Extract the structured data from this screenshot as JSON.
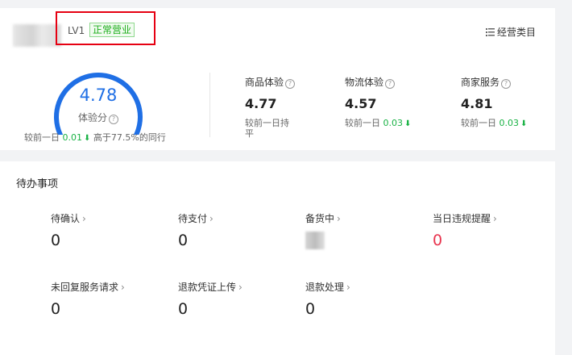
{
  "header": {
    "level": "LV1",
    "status": "正常营业",
    "category_link": "经营类目"
  },
  "score": {
    "value": "4.78",
    "fraction": 0.95,
    "label": "体验分",
    "compare_prefix": "较前一日",
    "compare_delta": "0.01",
    "compare_suffix": "高于77.5%的同行"
  },
  "metrics": [
    {
      "title": "商品体验",
      "value": "4.77",
      "sub": "较前一日持平",
      "delta": ""
    },
    {
      "title": "物流体验",
      "value": "4.57",
      "sub": "较前一日",
      "delta": "0.03"
    },
    {
      "title": "商家服务",
      "value": "4.81",
      "sub": "较前一日",
      "delta": "0.03"
    }
  ],
  "todo": {
    "title": "待办事项",
    "items": [
      {
        "label": "待确认",
        "value": "0"
      },
      {
        "label": "待支付",
        "value": "0"
      },
      {
        "label": "备货中",
        "value": ""
      },
      {
        "label": "当日违规提醒",
        "value": "0"
      },
      {
        "label": "未回复服务请求",
        "value": "0"
      },
      {
        "label": "退款凭证上传",
        "value": "0"
      },
      {
        "label": "退款处理",
        "value": "0"
      }
    ]
  },
  "colors": {
    "accent": "#1f6fe5",
    "positive": "#19b244",
    "alert": "#e8344e",
    "highlight_box": "#e60012"
  },
  "icons": {
    "category": "list-icon",
    "help": "question-circle-icon",
    "trend_down": "arrow-down-icon",
    "chevron": "chevron-right-icon"
  }
}
